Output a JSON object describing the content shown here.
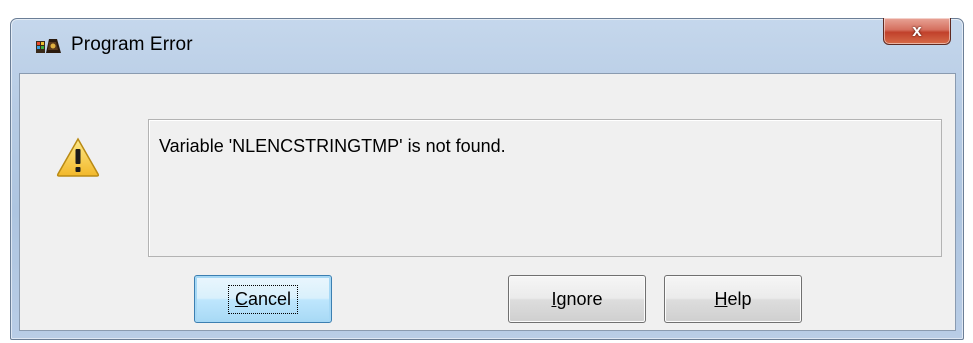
{
  "window": {
    "title": "Program Error",
    "close_glyph": "x"
  },
  "icons": {
    "title": "program-error-icon",
    "message": "warning-icon",
    "close": "close-icon"
  },
  "message": {
    "text": "Variable 'NLENCSTRINGTMP' is not found."
  },
  "buttons": {
    "cancel": {
      "accel": "C",
      "rest": "ancel"
    },
    "ignore": {
      "accel": "I",
      "rest": "gnore"
    },
    "help": {
      "accel": "H",
      "rest": "elp"
    }
  },
  "colors": {
    "close_button": "#c1412b",
    "warning_fill": "#f7d33c",
    "default_button": "#a7d9f5"
  }
}
